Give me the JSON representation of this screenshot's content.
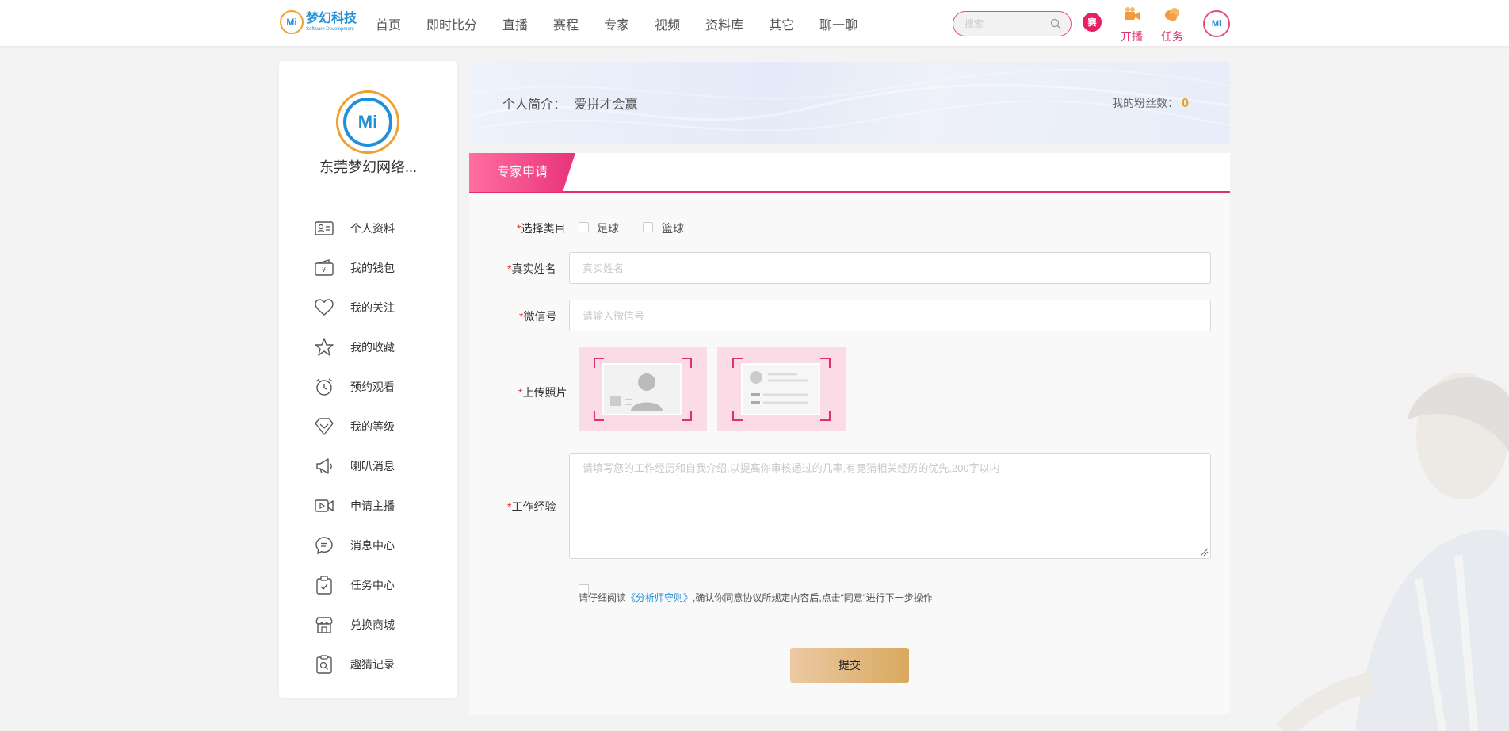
{
  "header": {
    "logo": {
      "name": "梦幻科技",
      "sub": "Software Development",
      "mark": "Mi"
    },
    "nav": [
      "首页",
      "即时比分",
      "直播",
      "赛程",
      "专家",
      "视频",
      "资料库",
      "其它",
      "聊一聊"
    ],
    "search_placeholder": "搜索",
    "badge": "赛",
    "live_label": "开播",
    "task_label": "任务",
    "avatar_mark": "Mi"
  },
  "sidebar": {
    "avatar_mark": "Mi",
    "username": "东莞梦幻网络...",
    "items": [
      {
        "label": "个人资料",
        "icon": "id-card-icon"
      },
      {
        "label": "我的钱包",
        "icon": "wallet-icon"
      },
      {
        "label": "我的关注",
        "icon": "heart-icon"
      },
      {
        "label": "我的收藏",
        "icon": "star-icon"
      },
      {
        "label": "预约观看",
        "icon": "alarm-clock-icon"
      },
      {
        "label": "我的等级",
        "icon": "diamond-icon"
      },
      {
        "label": "喇叭消息",
        "icon": "megaphone-icon"
      },
      {
        "label": "申请主播",
        "icon": "video-camera-icon"
      },
      {
        "label": "消息中心",
        "icon": "chat-bubble-icon"
      },
      {
        "label": "任务中心",
        "icon": "clipboard-check-icon"
      },
      {
        "label": "兑换商城",
        "icon": "store-icon"
      },
      {
        "label": "趣猜记录",
        "icon": "search-record-icon"
      }
    ]
  },
  "banner": {
    "intro_label": "个人简介：",
    "intro_value": "爱拼才会赢",
    "fans_label": "我的粉丝数：",
    "fans_count": "0"
  },
  "form": {
    "tab": "专家申请",
    "required_mark": "*",
    "category_label": "选择类目",
    "category_options": [
      "足球",
      "篮球"
    ],
    "name_label": "真实姓名",
    "name_placeholder": "真实姓名",
    "wechat_label": "微信号",
    "wechat_placeholder": "请输入微信号",
    "photo_label": "上传照片",
    "experience_label": "工作经验",
    "experience_placeholder": "请填写您的工作经历和自我介绍,以提高你审核通过的几率,有竞猜相关经历的优先,200字以内",
    "agree_prefix": "请仔细阅读",
    "agree_link": "《分析师守则》",
    "agree_suffix": ",确认你同意协议所规定内容后,点击“同意”进行下一步操作",
    "submit": "提交"
  },
  "colors": {
    "accent": "#e0306e",
    "brand_blue": "#1f8fd8",
    "gold": "#d9a95e"
  }
}
